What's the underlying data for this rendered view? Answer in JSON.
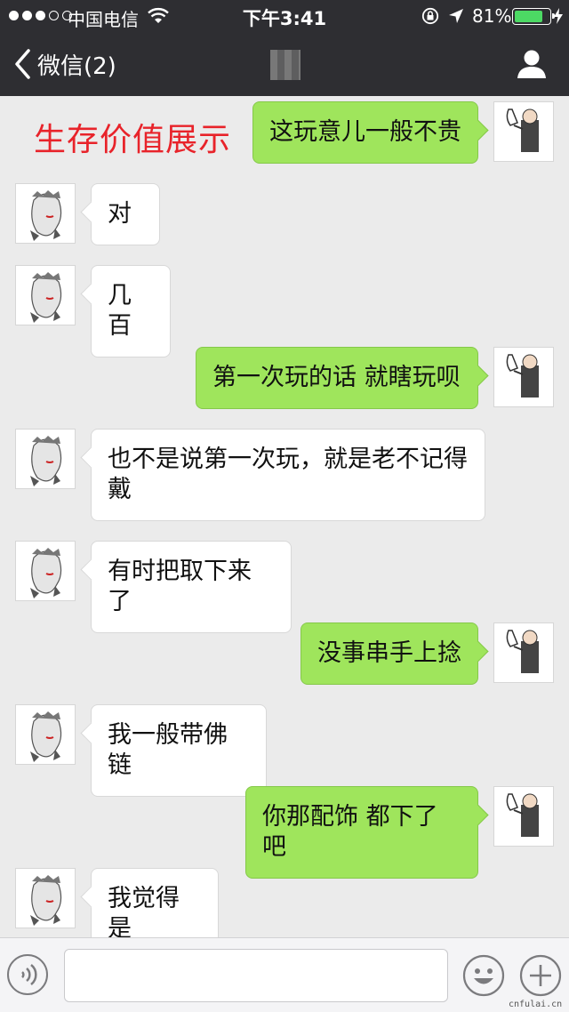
{
  "status_bar": {
    "carrier": "中国电信",
    "time": "下午3:41",
    "battery_percent": "81%",
    "battery_level": 0.81,
    "battery_color": "#4cd964",
    "icons": [
      "signal-dots-icon",
      "wifi-icon",
      "orientation-lock-icon",
      "location-arrow-icon",
      "battery-icon",
      "charging-bolt-icon"
    ]
  },
  "nav": {
    "back_label": "微信(2)",
    "icons": [
      "chevron-left-icon",
      "person-icon"
    ]
  },
  "overlay_caption": "生存价值展示",
  "messages": [
    {
      "side": "right",
      "text": "这玩意儿一般不贵"
    },
    {
      "side": "left",
      "text": "对"
    },
    {
      "side": "left",
      "text": "几百"
    },
    {
      "side": "right",
      "text": "第一次玩的话 就瞎玩呗"
    },
    {
      "side": "left",
      "text": "也不是说第一次玩，就是老不记得戴"
    },
    {
      "side": "left",
      "text": "有时把取下来了"
    },
    {
      "side": "right",
      "text": "没事串手上捻"
    },
    {
      "side": "left",
      "text": "我一般带佛链"
    },
    {
      "side": "right",
      "text": "你那配饰 都下了吧"
    },
    {
      "side": "left",
      "text": "我觉得是"
    }
  ],
  "colors": {
    "header_bg": "#2e2e32",
    "chat_bg": "#ebebeb",
    "sent_bubble": "#9fe55c",
    "received_bubble": "#ffffff",
    "overlay_text": "#e8232a"
  },
  "input_bar": {
    "placeholder": "",
    "icons": [
      "voice-icon",
      "emoji-icon",
      "plus-icon"
    ]
  },
  "watermark": "cnfulai.cn"
}
